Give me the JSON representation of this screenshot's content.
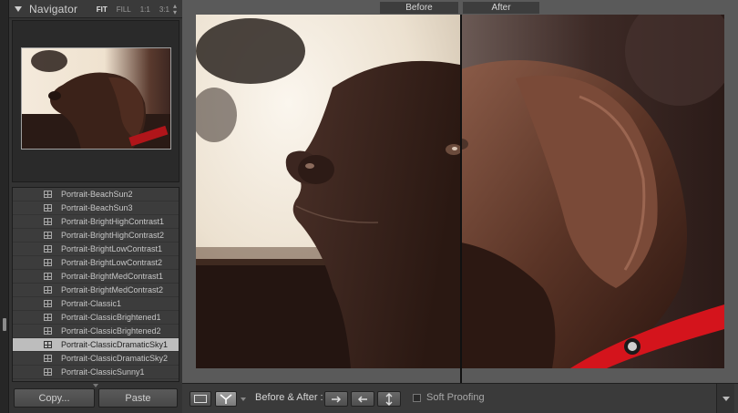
{
  "navigator": {
    "title": "Navigator",
    "zoom_options": [
      "FIT",
      "FILL",
      "1:1",
      "3:1"
    ],
    "active_zoom": "FIT"
  },
  "presets": {
    "items": [
      "Portrait-BeachSun2",
      "Portrait-BeachSun3",
      "Portrait-BrightHighContrast1",
      "Portrait-BrightHighContrast2",
      "Portrait-BrightLowContrast1",
      "Portrait-BrightLowContrast2",
      "Portrait-BrightMedContrast1",
      "Portrait-BrightMedContrast2",
      "Portrait-Classic1",
      "Portrait-ClassicBrightened1",
      "Portrait-ClassicBrightened2",
      "Portrait-ClassicDramaticSky1",
      "Portrait-ClassicDramaticSky2",
      "Portrait-ClassicSunny1"
    ],
    "selected": "Portrait-ClassicDramaticSky1"
  },
  "buttons": {
    "copy": "Copy...",
    "paste": "Paste"
  },
  "compare": {
    "before_label": "Before",
    "after_label": "After"
  },
  "toolbar": {
    "before_after_label": "Before & After :",
    "soft_proofing_label": "Soft Proofing"
  },
  "colors": {
    "panel": "#333333",
    "selected_row": "#bdbdbd",
    "toolbar": "#3a3a3a"
  }
}
